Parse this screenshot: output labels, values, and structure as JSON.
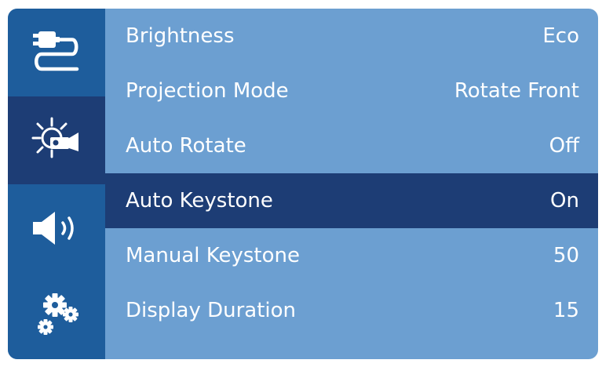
{
  "sidebar": {
    "items": [
      {
        "icon": "cable-icon",
        "selected": false
      },
      {
        "icon": "brightness-projector-icon",
        "selected": true
      },
      {
        "icon": "speaker-icon",
        "selected": false
      },
      {
        "icon": "gears-icon",
        "selected": false
      }
    ]
  },
  "menu": {
    "items": [
      {
        "label": "Brightness",
        "value": "Eco",
        "selected": false
      },
      {
        "label": "Projection Mode",
        "value": "Rotate Front",
        "selected": false
      },
      {
        "label": "Auto Rotate",
        "value": "Off",
        "selected": false
      },
      {
        "label": "Auto Keystone",
        "value": "On",
        "selected": true
      },
      {
        "label": "Manual Keystone",
        "value": "50",
        "selected": false
      },
      {
        "label": "Display Duration",
        "value": "15",
        "selected": false
      }
    ]
  },
  "colors": {
    "panel_bg": "#6c9fd1",
    "sidebar_bg": "#1e5d9c",
    "selected_bg": "#1d3d75",
    "text": "#ffffff"
  }
}
